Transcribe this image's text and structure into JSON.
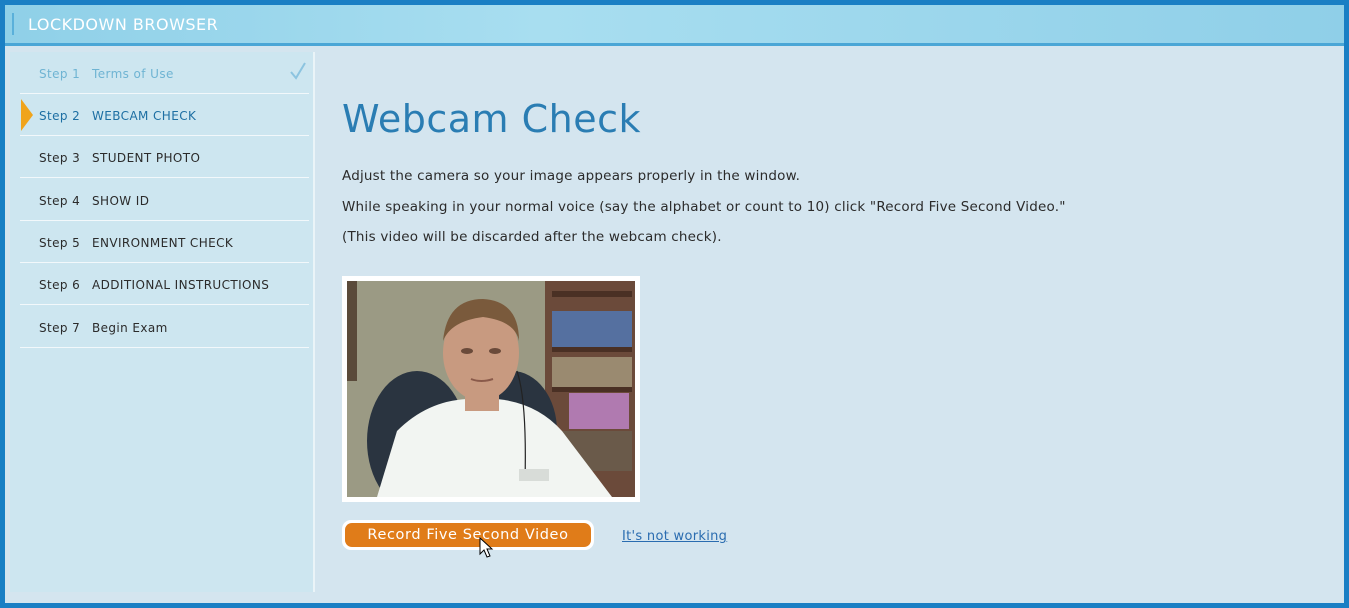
{
  "app": {
    "title": "LOCKDOWN BROWSER"
  },
  "steps": [
    {
      "num": "Step 1",
      "label": "Terms of Use",
      "state": "done"
    },
    {
      "num": "Step 2",
      "label": "WEBCAM CHECK",
      "state": "active"
    },
    {
      "num": "Step 3",
      "label": "STUDENT PHOTO",
      "state": "pending"
    },
    {
      "num": "Step 4",
      "label": "SHOW ID",
      "state": "pending"
    },
    {
      "num": "Step 5",
      "label": "ENVIRONMENT CHECK",
      "state": "pending"
    },
    {
      "num": "Step 6",
      "label": "ADDITIONAL INSTRUCTIONS",
      "state": "pending"
    },
    {
      "num": "Step 7",
      "label": "Begin Exam",
      "state": "pending"
    }
  ],
  "main": {
    "heading": "Webcam Check",
    "instructions": [
      "Adjust the camera so your image appears properly in the window.",
      "While speaking in your normal voice (say the alphabet or count to 10) click \"Record Five Second Video.\"",
      "(This video will be discarded after the webcam check)."
    ],
    "record_button": "Record Five Second Video",
    "not_working_link": "It's not working"
  },
  "colors": {
    "accent": "#2a7db3",
    "button": "#e07c19",
    "active_marker": "#f0a41c",
    "frame": "#1a7fc4"
  }
}
